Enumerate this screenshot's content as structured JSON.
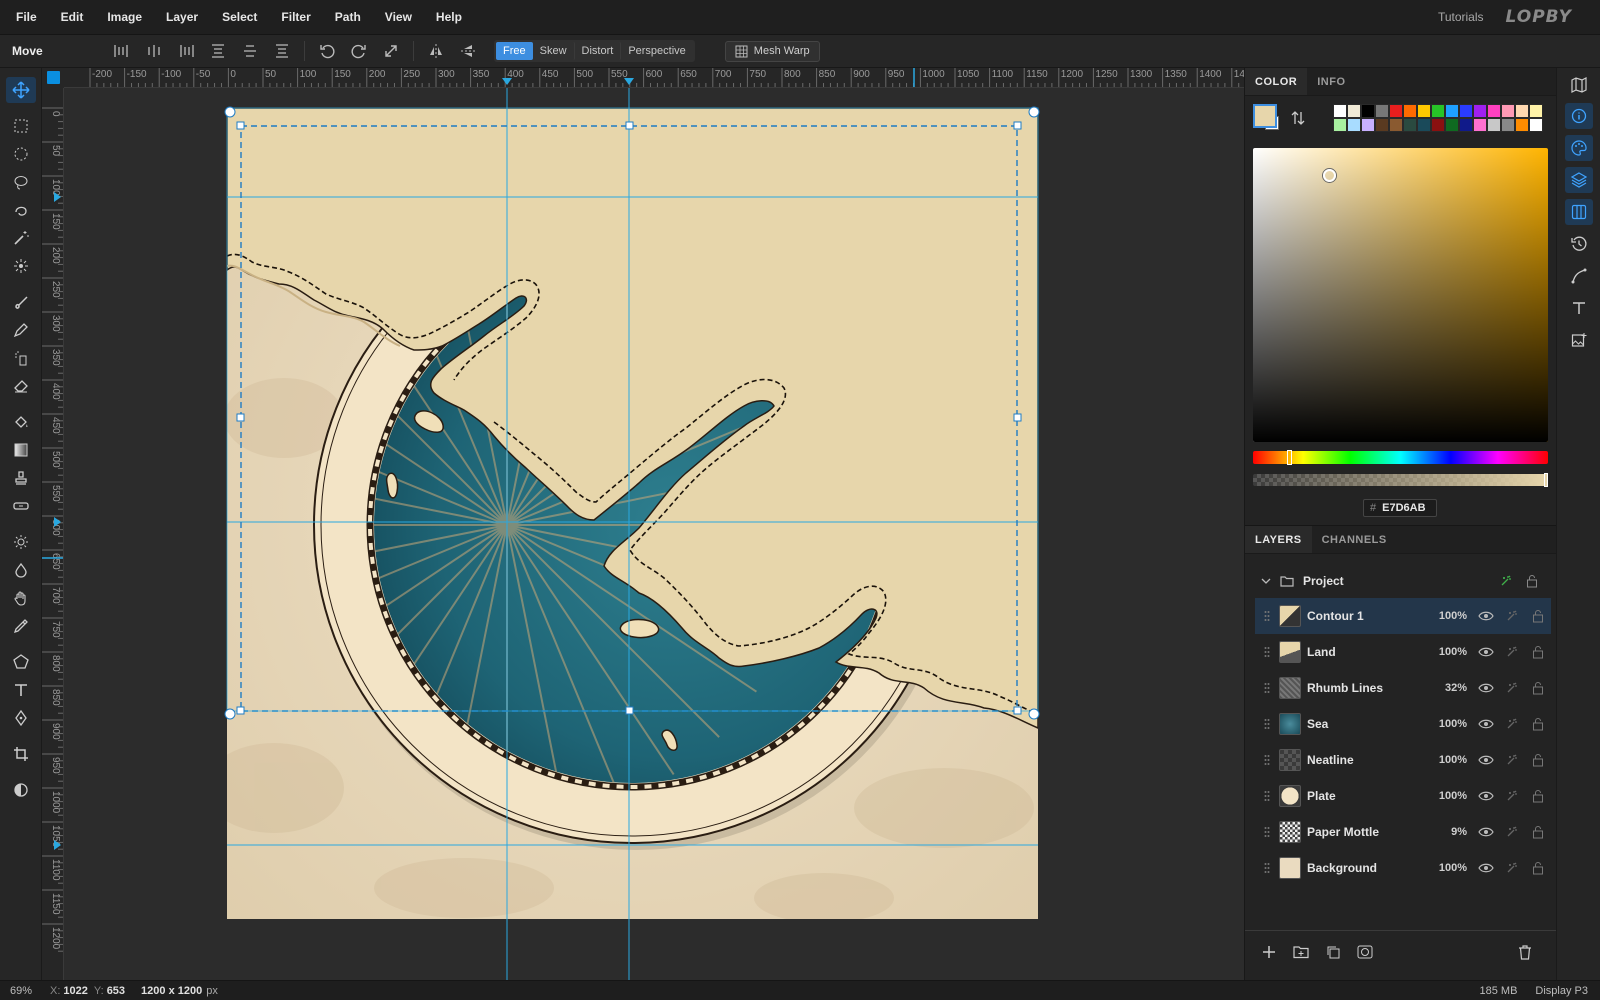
{
  "menu": [
    "File",
    "Edit",
    "Image",
    "Layer",
    "Select",
    "Filter",
    "Path",
    "View",
    "Help"
  ],
  "header": {
    "tutorials": "Tutorials",
    "logo": "LOPBY"
  },
  "options": {
    "tool_name": "Move",
    "modes": [
      "Free",
      "Skew",
      "Distort",
      "Perspective"
    ],
    "active_mode": "Free",
    "mesh_warp": "Mesh Warp"
  },
  "ruler": {
    "h_labels": [
      "-200",
      "-150",
      "-100",
      "-50",
      "0",
      "50",
      "100",
      "150",
      "200",
      "250",
      "300",
      "350",
      "400",
      "450",
      "500",
      "550",
      "600",
      "650",
      "700",
      "750",
      "800",
      "850",
      "900",
      "950",
      "1000",
      "1050",
      "1100",
      "1150",
      "1200",
      "1250",
      "1300",
      "1350",
      "1400",
      "14"
    ],
    "v_labels": [
      "0",
      "50",
      "100",
      "150",
      "200",
      "250",
      "300",
      "350",
      "400",
      "450",
      "500",
      "550",
      "600",
      "650",
      "700",
      "750",
      "800",
      "850",
      "900",
      "950",
      "1000",
      "1050",
      "1100",
      "1150",
      "1200"
    ]
  },
  "color_panel": {
    "tabs": [
      "COLOR",
      "INFO"
    ],
    "active_tab": "COLOR",
    "fg_color": "#E7D6AB",
    "bg_color": "#FFFFFF",
    "hex_prefix": "#",
    "hex": "E7D6AB",
    "palette_top": [
      "#ffffff",
      "#f0ead6",
      "#000000",
      "#777777",
      "#e81e1e",
      "#ff6a00",
      "#ffc800",
      "#27c427",
      "#1ea0ff",
      "#2a3cff",
      "#a020f0",
      "#ff40c0",
      "#ff9ab5",
      "#ffd8b0",
      "#fff3a8"
    ],
    "palette_bottom": [
      "#a8f0a0",
      "#a8dcff",
      "#c8b0ff",
      "#5a3a20",
      "#8a5a30",
      "#2a4a40",
      "#1a4a5a",
      "#8a1010",
      "#0f6a20",
      "#101a8a",
      "#ff70d0",
      "#c8c8c8",
      "#888888",
      "#ff8c00",
      "#ffffff"
    ]
  },
  "layers_panel": {
    "tabs": [
      "LAYERS",
      "CHANNELS"
    ],
    "active_tab": "LAYERS",
    "group": "Project",
    "layers": [
      {
        "name": "Contour 1",
        "opacity": "100%",
        "selected": true,
        "thumb": "contour"
      },
      {
        "name": "Land",
        "opacity": "100%",
        "selected": false,
        "thumb": "land"
      },
      {
        "name": "Rhumb Lines",
        "opacity": "32%",
        "selected": false,
        "thumb": "rhumb"
      },
      {
        "name": "Sea",
        "opacity": "100%",
        "selected": false,
        "thumb": "sea"
      },
      {
        "name": "Neatline",
        "opacity": "100%",
        "selected": false,
        "thumb": "checker"
      },
      {
        "name": "Plate",
        "opacity": "100%",
        "selected": false,
        "thumb": "plate"
      },
      {
        "name": "Paper Mottle",
        "opacity": "9%",
        "selected": false,
        "thumb": "mottle"
      },
      {
        "name": "Background",
        "opacity": "100%",
        "selected": false,
        "thumb": "bg"
      }
    ]
  },
  "status": {
    "zoom": "69%",
    "x_label": "X:",
    "x": "1022",
    "y_label": "Y:",
    "y": "653",
    "doc_size": "1200 x 1200",
    "doc_unit": "px",
    "memory": "185 MB",
    "color_profile": "Display P3"
  },
  "colors": {
    "accent": "#3d8ee0",
    "guide": "#2aa8e0",
    "sea": "#2a7386",
    "land": "#e7d6ab",
    "plate": "#f3e4c6"
  }
}
